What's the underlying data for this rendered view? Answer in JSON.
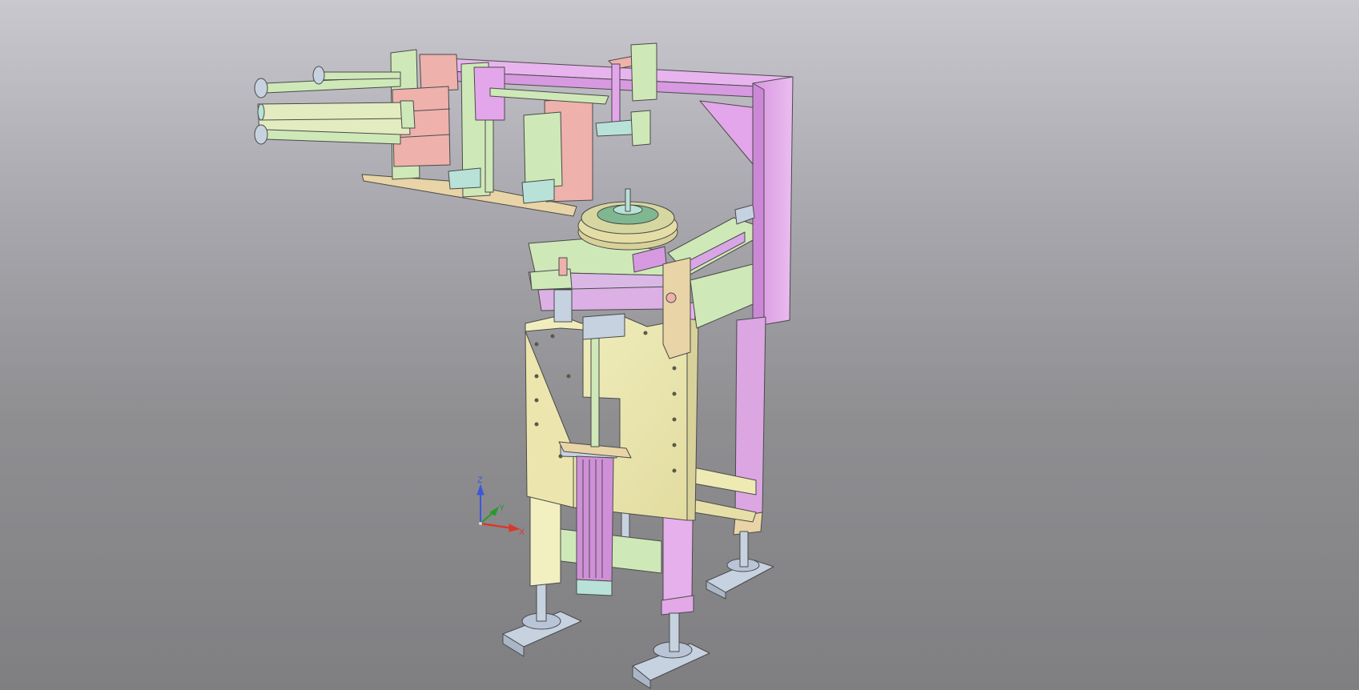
{
  "viewport": {
    "background_top": "#c9c8ce",
    "background_bottom": "#7f7f82"
  },
  "model": {
    "description_visible": false,
    "colors": {
      "frame_purple": "#e2a8e8",
      "plate_yellow": "#eeeab4",
      "part_green": "#cfe8b8",
      "part_salmon": "#eeb1ac",
      "part_steel": "#c6d2e0",
      "part_teal": "#b8e2d8",
      "part_tan": "#e8d4a6",
      "outline": "#4a4a4a"
    }
  },
  "triad": {
    "x_label": "X",
    "y_label": "Y",
    "z_label": "Z",
    "x_color": "#d83a2a",
    "y_color": "#2a9a2a",
    "z_color": "#3a58d8"
  }
}
